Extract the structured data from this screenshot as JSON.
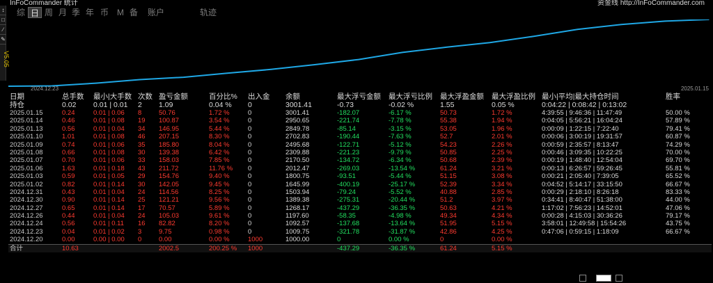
{
  "title_left": "InFoCommander 统计",
  "title_right": "资金线 http://InFoCommander.com",
  "version": "V5.05",
  "tabs": [
    {
      "label": "综",
      "active": false
    },
    {
      "label": "日",
      "active": true
    },
    {
      "label": "周",
      "active": false
    },
    {
      "label": "月",
      "active": false
    },
    {
      "label": "季",
      "active": false
    },
    {
      "label": "年",
      "active": false
    },
    {
      "label": "币",
      "active": false
    },
    {
      "label": "M",
      "active": false
    },
    {
      "label": "备",
      "active": false
    },
    {
      "label": "账户",
      "active": false
    },
    {
      "label": "轨迹",
      "active": false
    }
  ],
  "chart_data": {
    "type": "line",
    "x_start_label": "2024.12.23",
    "x_end_label": "2025.01.15",
    "x": [
      "2024.12.20",
      "2024.12.23",
      "2024.12.24",
      "2024.12.26",
      "2024.12.27",
      "2024.12.30",
      "2024.12.31",
      "2025.01.02",
      "2025.01.03",
      "2025.01.06",
      "2025.01.07",
      "2025.01.08",
      "2025.01.09",
      "2025.01.10",
      "2025.01.13",
      "2025.01.14",
      "2025.01.15"
    ],
    "values": [
      1000,
      1009.75,
      1092.57,
      1197.6,
      1268.17,
      1389.38,
      1503.94,
      1645.99,
      1800.75,
      2012.47,
      2170.5,
      2309.88,
      2495.68,
      2702.83,
      2849.78,
      2950.65,
      3001.41
    ],
    "line_color": "#1fa8e6"
  },
  "table": {
    "headers": [
      "日期",
      "总手数",
      "最小|大手数",
      "次数",
      "盈亏金额",
      "百分比%",
      "出入金",
      "余额",
      "最大浮亏金额",
      "最大浮亏比例",
      "最大浮盈金额",
      "最大浮盈比例",
      "最小|平均|最大持仓时间",
      "胜率"
    ],
    "position_row": [
      "持仓",
      "0.02",
      "0.01 | 0.01",
      "2",
      "1.09",
      "0.04 %",
      "0",
      "3001.41",
      "-0.73",
      "-0.02 %",
      "1.55",
      "0.05 %",
      "0:04:22 | 0:08:42 | 0:13:02",
      ""
    ],
    "rows": [
      [
        "2025.01.15",
        "0.24",
        "0.01 | 0.06",
        "8",
        "50.76",
        "1.72 %",
        "0",
        "3001.41",
        "-182.07",
        "-6.17 %",
        "50.73",
        "1.72 %",
        "4:39:55 | 9:46:36 | 11:47:49",
        "50.00 %"
      ],
      [
        "2025.01.14",
        "0.46",
        "0.01 | 0.08",
        "19",
        "100.87",
        "3.54 %",
        "0",
        "2950.65",
        "-221.74",
        "-7.78 %",
        "55.38",
        "1.94 %",
        "0:04:05 | 5:56:21 | 16:04:24",
        "57.89 %"
      ],
      [
        "2025.01.13",
        "0.56",
        "0.01 | 0.04",
        "34",
        "146.95",
        "5.44 %",
        "0",
        "2849.78",
        "-85.14",
        "-3.15 %",
        "53.05",
        "1.96 %",
        "0:00:09 | 1:22:15 | 7:22:40",
        "79.41 %"
      ],
      [
        "2025.01.10",
        "1.01",
        "0.01 | 0.08",
        "46",
        "207.15",
        "8.30 %",
        "0",
        "2702.83",
        "-190.44",
        "-7.63 %",
        "52.7",
        "2.01 %",
        "0:00:06 | 3:00:19 | 19:31:57",
        "60.87 %"
      ],
      [
        "2025.01.09",
        "0.74",
        "0.01 | 0.06",
        "35",
        "185.80",
        "8.04 %",
        "0",
        "2495.68",
        "-122.71",
        "-5.12 %",
        "54.23",
        "2.26 %",
        "0:00:59 | 2:35:57 | 8:13:47",
        "74.29 %"
      ],
      [
        "2025.01.08",
        "0.66",
        "0.01 | 0.08",
        "30",
        "139.38",
        "6.42 %",
        "0",
        "2309.88",
        "-221.23",
        "-9.79 %",
        "50.85",
        "2.25 %",
        "0:00:46 | 3:09:35 | 10:22:25",
        "70.00 %"
      ],
      [
        "2025.01.07",
        "0.70",
        "0.01 | 0.06",
        "33",
        "158.03",
        "7.85 %",
        "0",
        "2170.50",
        "-134.72",
        "-6.34 %",
        "50.68",
        "2.39 %",
        "0:00:19 | 1:48:40 | 12:54:04",
        "69.70 %"
      ],
      [
        "2025.01.06",
        "1.63",
        "0.01 | 0.18",
        "43",
        "211.72",
        "11.76 %",
        "0",
        "2012.47",
        "-269.03",
        "-13.54 %",
        "61.24",
        "3.21 %",
        "0:00:13 | 6:26:57 | 59:26:45",
        "55.81 %"
      ],
      [
        "2025.01.03",
        "0.59",
        "0.01 | 0.05",
        "29",
        "154.76",
        "9.40 %",
        "0",
        "1800.75",
        "-93.51",
        "-5.44 %",
        "51.15",
        "3.08 %",
        "0:00:21 | 2:05:40 | 7:39:05",
        "65.52 %"
      ],
      [
        "2025.01.02",
        "0.82",
        "0.01 | 0.14",
        "30",
        "142.05",
        "9.45 %",
        "0",
        "1645.99",
        "-400.19",
        "-25.17 %",
        "52.39",
        "3.34 %",
        "0:04:52 | 5:14:17 | 33:15:50",
        "66.67 %"
      ],
      [
        "2024.12.31",
        "0.43",
        "0.01 | 0.04",
        "24",
        "114.56",
        "8.25 %",
        "0",
        "1503.94",
        "-79.24",
        "-5.52 %",
        "40.88",
        "2.85 %",
        "0:00:29 | 2:18:10 | 8:26:18",
        "83.33 %"
      ],
      [
        "2024.12.30",
        "0.90",
        "0.01 | 0.14",
        "25",
        "121.21",
        "9.56 %",
        "0",
        "1389.38",
        "-275.31",
        "-20.44 %",
        "51.2",
        "3.97 %",
        "0:34:41 | 8:40:47 | 51:38:00",
        "44.00 %"
      ],
      [
        "2024.12.27",
        "0.65",
        "0.01 | 0.14",
        "17",
        "70.57",
        "5.89 %",
        "0",
        "1268.17",
        "-437.29",
        "-36.35 %",
        "50.63",
        "4.21 %",
        "1:17:02 | 7:56:23 | 14:52:01",
        "47.06 %"
      ],
      [
        "2024.12.26",
        "0.44",
        "0.01 | 0.04",
        "24",
        "105.03",
        "9.61 %",
        "0",
        "1197.60",
        "-58.35",
        "-4.98 %",
        "49.34",
        "4.34 %",
        "0:00:28 | 4:15:03 | 30:36:26",
        "79.17 %"
      ],
      [
        "2024.12.24",
        "0.56",
        "0.01 | 0.11",
        "16",
        "82.82",
        "8.20 %",
        "0",
        "1092.57",
        "-137.68",
        "-13.64 %",
        "51.95",
        "5.15 %",
        "3:58:01 | 12:49:58 | 15:54:26",
        "43.75 %"
      ],
      [
        "2024.12.23",
        "0.04",
        "0.01 | 0.02",
        "3",
        "9.75",
        "0.98 %",
        "0",
        "1009.75",
        "-321.78",
        "-31.87 %",
        "42.86",
        "4.25 %",
        "0:47:06 | 0:59:15 | 1:18:09",
        "66.67 %"
      ],
      [
        "2024.12.20",
        "0.00",
        "0.00 | 0.00",
        "0",
        "0.00",
        "0.00 %",
        "1000",
        "1000.00",
        "0",
        "0.00 %",
        "0",
        "0.00 %",
        "",
        ""
      ]
    ],
    "total_row": [
      "合计",
      "10.63",
      "",
      "",
      "2002.5",
      "200.25 %",
      "1000",
      "",
      "-437.29",
      "-36.35 %",
      "61.24",
      "5.15 %",
      "",
      ""
    ],
    "colors": {
      "loss": "#ff3b30",
      "gain": "#22e060",
      "neutral": "#dcdcdc"
    }
  }
}
